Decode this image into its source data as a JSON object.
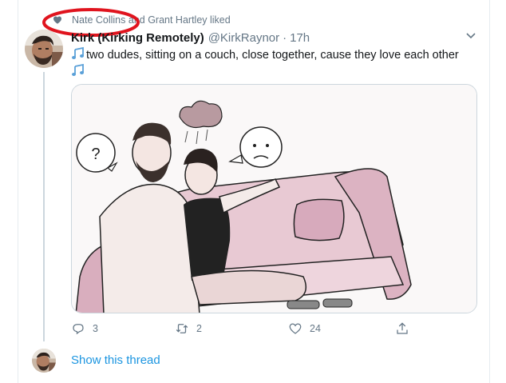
{
  "social_context": {
    "text": "Nate Collins and Grant Hartley liked",
    "icon": "heart-icon"
  },
  "tweet": {
    "display_name": "Kirk (Kirking Remotely)",
    "handle": "@KirkRaynor",
    "separator": "·",
    "time": "17h",
    "text": "two dudes, sitting on a couch, close together, cause they love each other",
    "text_emoji": "musical-notes-icon",
    "media_description_icon": "couch-illustration-image",
    "actions": {
      "reply_count": "3",
      "retweet_count": "2",
      "like_count": "24"
    }
  },
  "show_thread": {
    "label": "Show this thread"
  },
  "colors": {
    "accent": "#1b95e0",
    "secondary_text": "#657786",
    "highlight_circle": "#e0141e",
    "border": "#e6ecf0"
  }
}
